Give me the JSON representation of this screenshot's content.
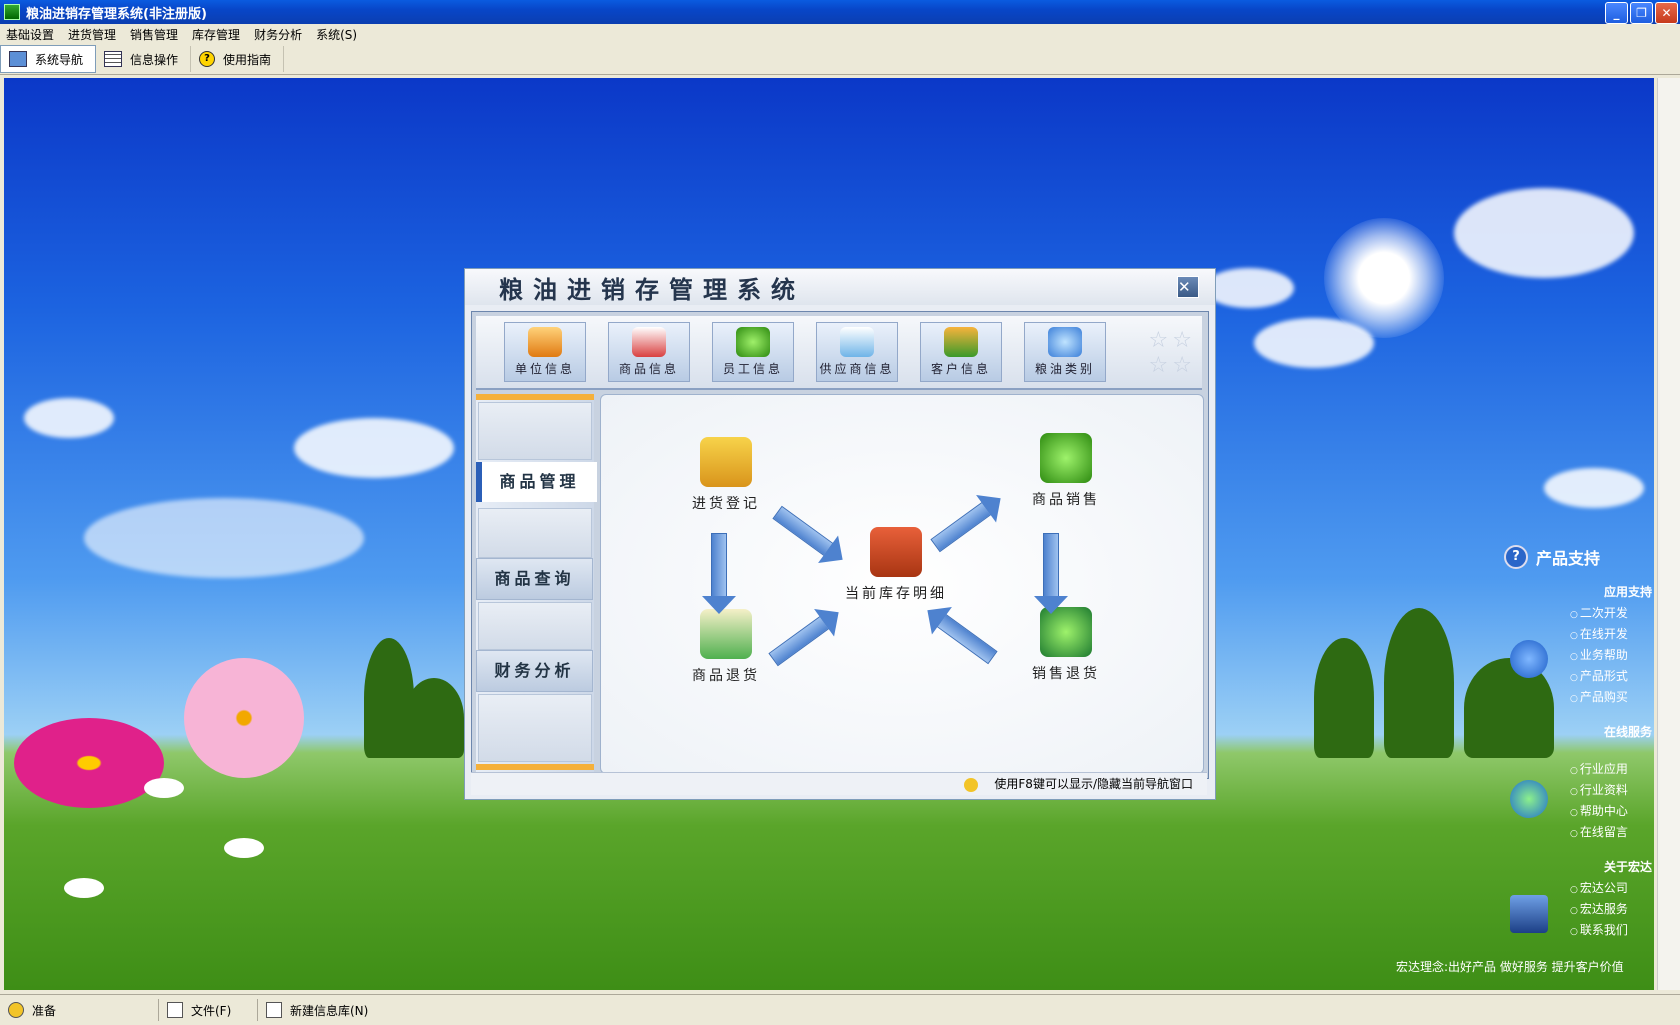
{
  "window": {
    "title": "粮油进销存管理系统(非注册版)"
  },
  "menu": [
    "基础设置",
    "进货管理",
    "销售管理",
    "库存管理",
    "财务分析",
    "系统(S)"
  ],
  "toolbar": {
    "nav": "系统导航",
    "info": "信息操作",
    "guide": "使用指南"
  },
  "dialog": {
    "title": "粮油进销存管理系统",
    "top_tabs": [
      "单位信息",
      "商品信息",
      "员工信息",
      "供应商信息",
      "客户信息",
      "粮油类别"
    ],
    "side_nav": {
      "product_mgmt": "商品管理",
      "product_query": "商品查询",
      "finance": "财务分析"
    },
    "flow": {
      "purchase": "进货登记",
      "sales": "商品销售",
      "inventory": "当前库存明细",
      "product_return": "商品退货",
      "sales_return": "销售退货"
    },
    "hint": "使用F8键可以显示/隐藏当前导航窗口"
  },
  "support": {
    "title": "产品支持",
    "app_support": "应用支持",
    "app_items": [
      "二次开发",
      "在线开发",
      "业务帮助",
      "产品形式",
      "产品购买"
    ],
    "online_service": "在线服务",
    "online_items": [
      "行业应用",
      "行业资料",
      "帮助中心",
      "在线留言"
    ],
    "about": "关于宏达",
    "about_items": [
      "宏达公司",
      "宏达服务",
      "联系我们"
    ],
    "slogan": "宏达理念:出好产品 做好服务 提升客户价值"
  },
  "statusbar": {
    "state": "准备",
    "file": "文件(F)",
    "new_db": "新建信息库(N)"
  },
  "colors": {
    "title_blue": "#0846c8",
    "dialog_bg": "#e9edf4",
    "accent_orange": "#f5b03a"
  }
}
